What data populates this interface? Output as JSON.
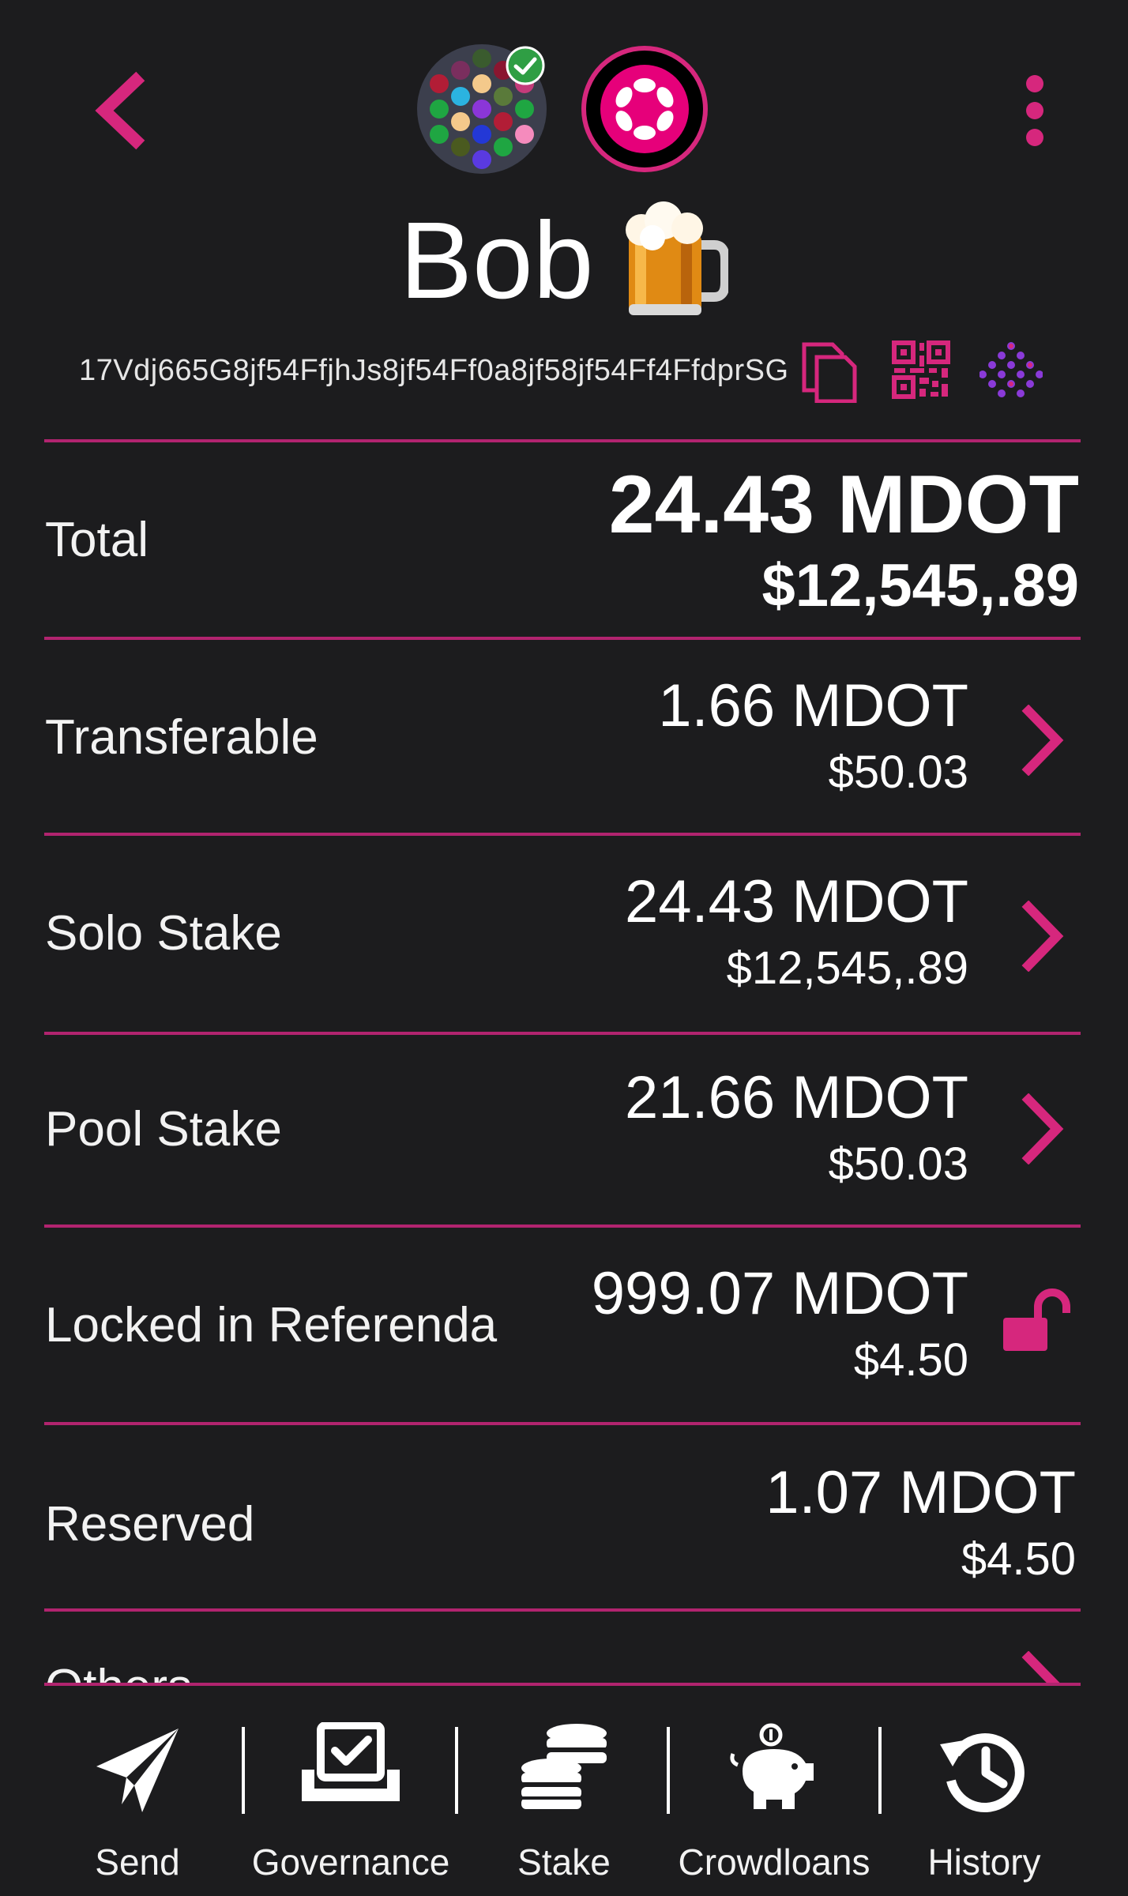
{
  "header": {
    "back_icon": "chevron-left-icon",
    "menu_icon": "more-vertical-icon",
    "identicon": "identicon-avatar",
    "verified_icon": "check-circle-icon",
    "chain_logo": "polkadot-logo-icon"
  },
  "account": {
    "name": "Bob",
    "emoji": "beer-mug-icon",
    "address": "17Vdj665G8jf54FfjhJs8jf54Ff0a8jf58jf54Ff4FfdprSG"
  },
  "balances": {
    "total": {
      "label": "Total",
      "amount": "24.43 MDOT",
      "fiat": "$12,545,.89"
    },
    "rows": [
      {
        "label": "Transferable",
        "amount": "1.66 MDOT",
        "fiat": "$50.03",
        "action_icon": "chevron-right-icon"
      },
      {
        "label": "Solo Stake",
        "amount": "24.43 MDOT",
        "fiat": "$12,545,.89",
        "action_icon": "chevron-right-icon"
      },
      {
        "label": "Pool Stake",
        "amount": "21.66 MDOT",
        "fiat": "$50.03",
        "action_icon": "chevron-right-icon"
      },
      {
        "label": "Locked in Referenda",
        "amount": "999.07 MDOT",
        "fiat": "$4.50",
        "action_icon": "lock-open-icon"
      },
      {
        "label": "Reserved",
        "amount": "1.07 MDOT",
        "fiat": "$4.50"
      },
      {
        "label": "Others",
        "action_icon": "chevron-right-icon"
      }
    ]
  },
  "nav": {
    "items": [
      {
        "label": "Send",
        "icon": "send-icon"
      },
      {
        "label": "Governance",
        "icon": "vote-icon"
      },
      {
        "label": "Stake",
        "icon": "coins-icon"
      },
      {
        "label": "Crowdloans",
        "icon": "piggy-bank-icon"
      },
      {
        "label": "History",
        "icon": "history-icon"
      }
    ]
  },
  "colors": {
    "background": "#1c1c1e",
    "accent": "#d6277d",
    "divider": "#b1246f",
    "text": "#ffffff"
  }
}
